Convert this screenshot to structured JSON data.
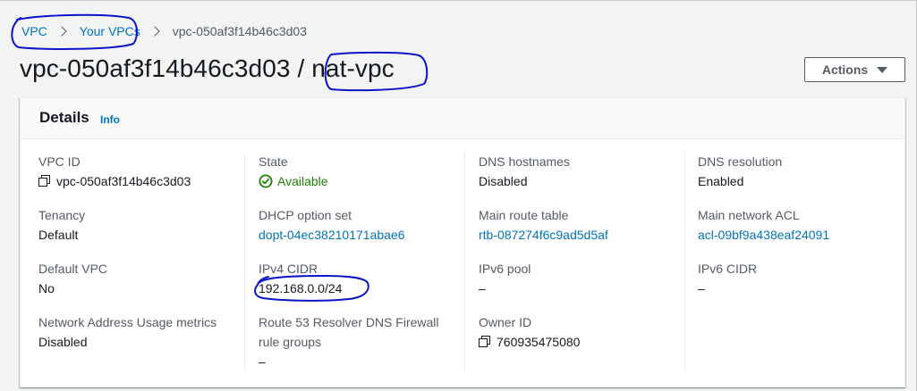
{
  "breadcrumb": {
    "items": [
      "VPC",
      "Your VPCs"
    ],
    "current": "vpc-050af3f14b46c3d03"
  },
  "header": {
    "title_id": "vpc-050af3f14b46c3d03",
    "title_sep": " / ",
    "title_name": "nat-vpc",
    "actions_label": "Actions"
  },
  "details": {
    "title": "Details",
    "info_label": "Info",
    "fields": {
      "vpc_id": {
        "label": "VPC ID",
        "value": "vpc-050af3f14b46c3d03"
      },
      "state": {
        "label": "State",
        "value": "Available"
      },
      "dns_hostnames": {
        "label": "DNS hostnames",
        "value": "Disabled"
      },
      "dns_resolution": {
        "label": "DNS resolution",
        "value": "Enabled"
      },
      "tenancy": {
        "label": "Tenancy",
        "value": "Default"
      },
      "dhcp_option_set": {
        "label": "DHCP option set",
        "value": "dopt-04ec38210171abae6"
      },
      "main_route_table": {
        "label": "Main route table",
        "value": "rtb-087274f6c9ad5d5af"
      },
      "main_network_acl": {
        "label": "Main network ACL",
        "value": "acl-09bf9a438eaf24091"
      },
      "default_vpc": {
        "label": "Default VPC",
        "value": "No"
      },
      "ipv4_cidr": {
        "label": "IPv4 CIDR",
        "value": "192.168.0.0/24"
      },
      "ipv6_pool": {
        "label": "IPv6 pool",
        "value": "–"
      },
      "ipv6_cidr": {
        "label": "IPv6 CIDR",
        "value": "–"
      },
      "network_address_usage_metrics": {
        "label": "Network Address Usage metrics",
        "value": "Disabled"
      },
      "route53_resolver_dns_firewall": {
        "label_line1": "Route 53 Resolver DNS Firewall",
        "label_line2": "rule groups",
        "value": "–"
      },
      "owner_id": {
        "label": "Owner ID",
        "value": "760935475080"
      }
    }
  },
  "icons": {
    "copy": "copy-icon",
    "status": "check-circle-icon",
    "actions_caret": "caret-down-icon",
    "breadcrumb_sep": "chevron-right-icon"
  },
  "colors": {
    "link": "#0073bb",
    "success": "#1d8102",
    "annotation": "#0a14c8",
    "button_border": "#545b64"
  }
}
